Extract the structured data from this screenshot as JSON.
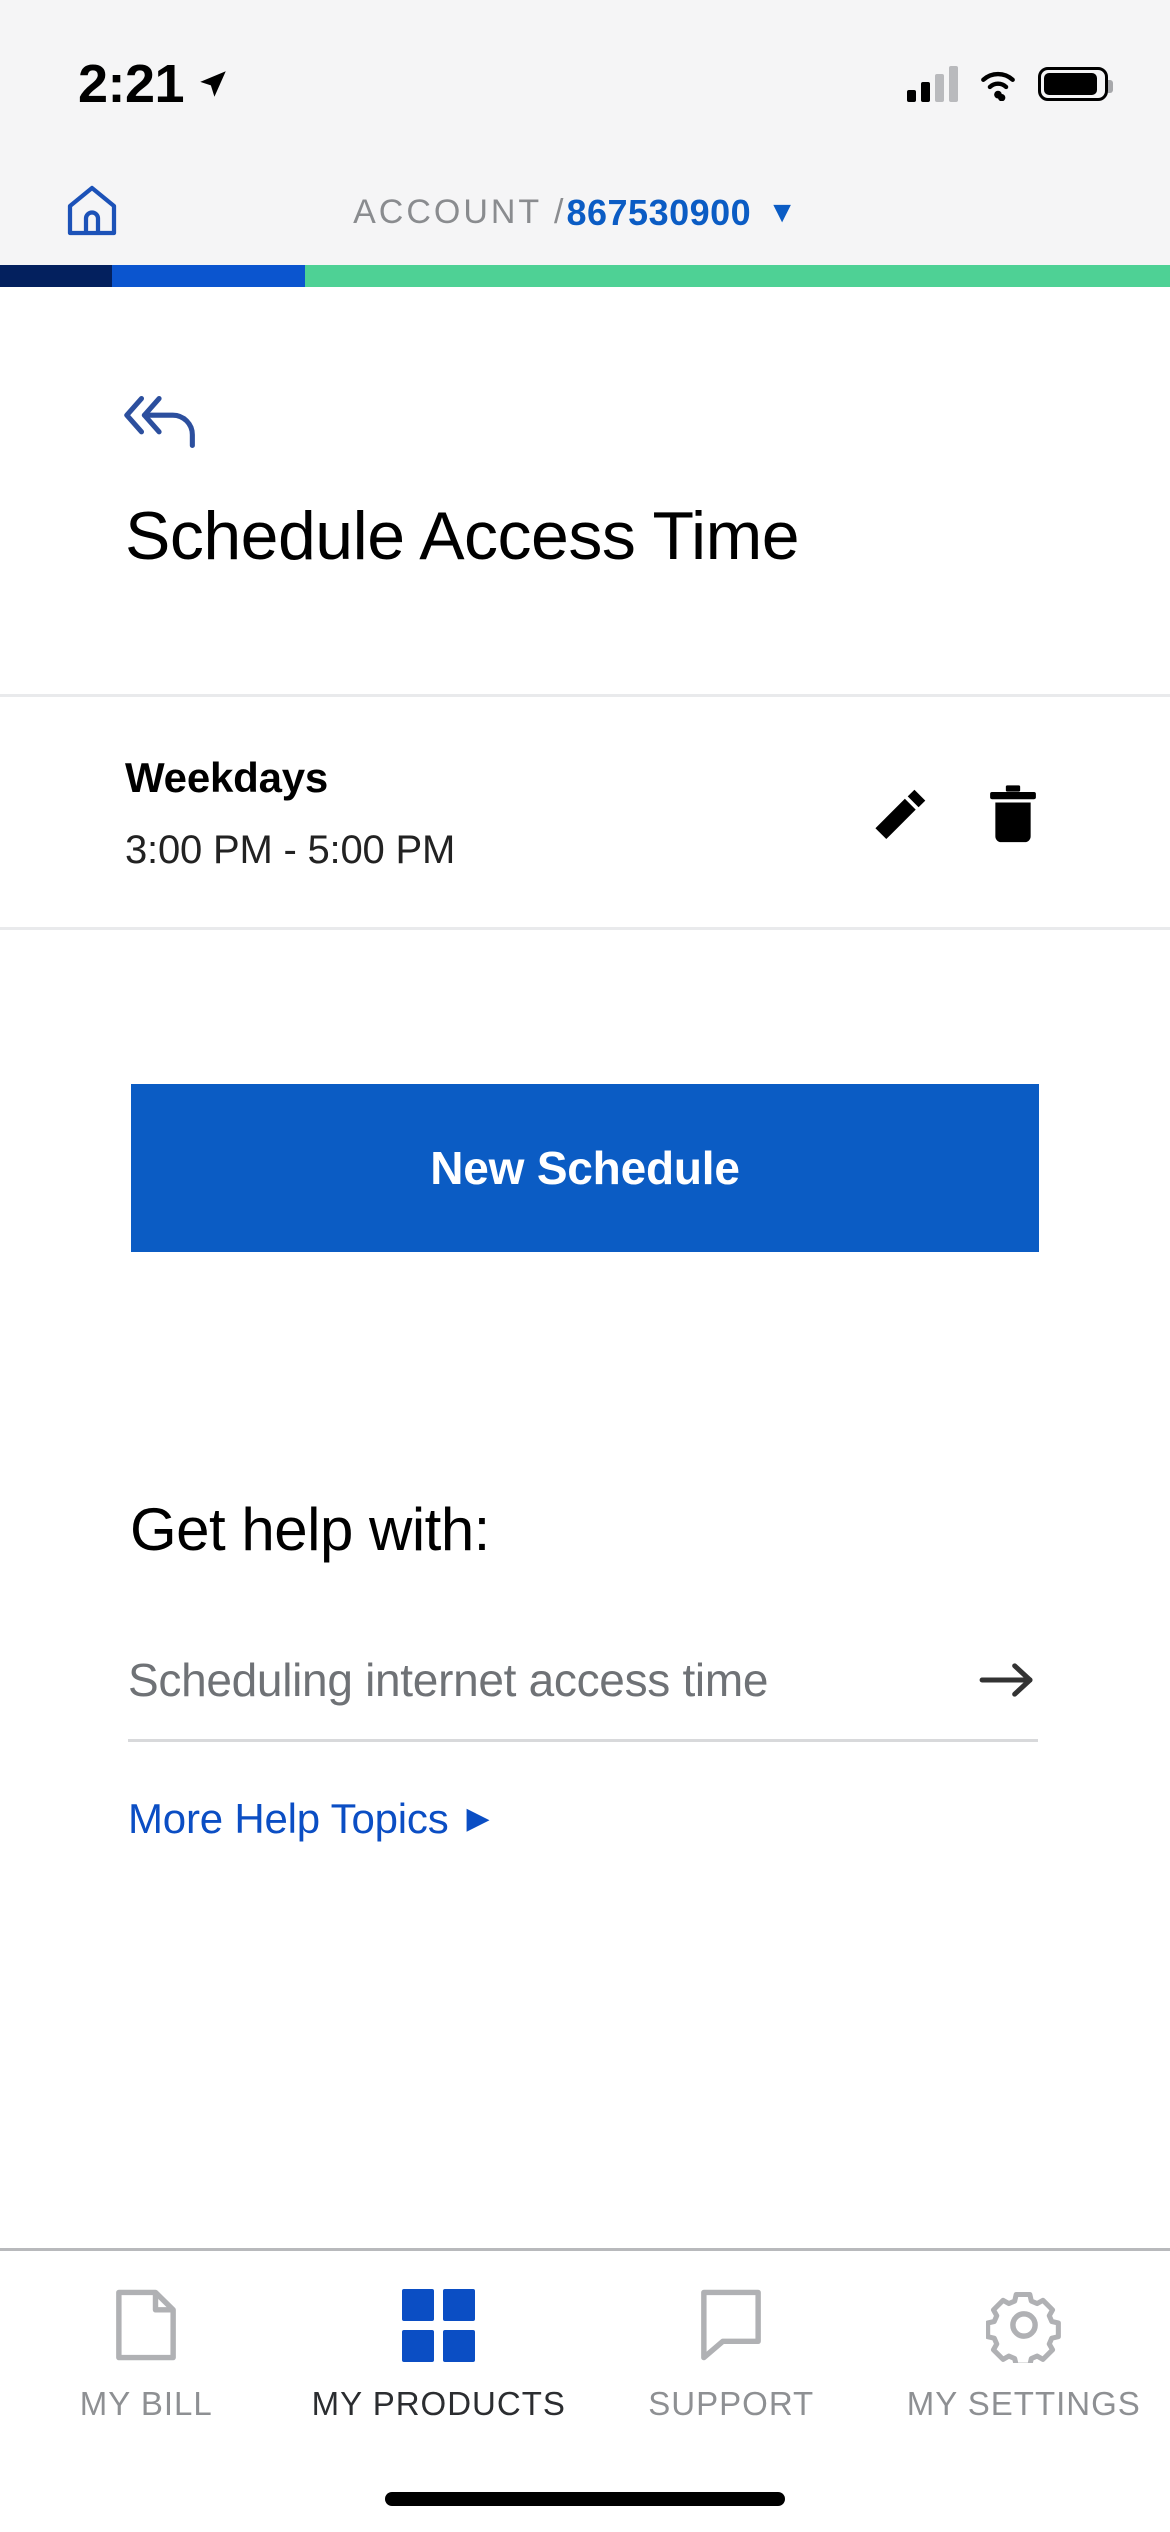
{
  "status_bar": {
    "time": "2:21",
    "location_icon": "location-arrow-icon",
    "signal_icon": "cellular-signal-icon",
    "wifi_icon": "wifi-icon",
    "battery_icon": "battery-icon"
  },
  "header": {
    "home_icon": "home-icon",
    "account_label": "ACCOUNT /",
    "account_number": "867530900",
    "caret": "▼",
    "accent_color": "#0b5cc4",
    "bar_colors": [
      "#03205e",
      "#0b55cf",
      "#4ed195"
    ]
  },
  "page": {
    "back_icon": "back-arrow-icon",
    "title": "Schedule Access Time"
  },
  "schedule": {
    "items": [
      {
        "days": "Weekdays",
        "time_range": "3:00 PM - 5:00 PM",
        "edit_icon": "pencil-icon",
        "delete_icon": "trash-icon"
      }
    ],
    "new_button_label": "New Schedule"
  },
  "help": {
    "heading": "Get help with:",
    "topics": [
      {
        "label": "Scheduling internet access time",
        "arrow_icon": "arrow-right-icon"
      }
    ],
    "more_link": "More Help Topics",
    "more_link_arrow": "▶"
  },
  "bottom_nav": {
    "items": [
      {
        "label": "MY BILL",
        "icon": "document-icon",
        "active": false
      },
      {
        "label": "MY PRODUCTS",
        "icon": "grid-icon",
        "active": true
      },
      {
        "label": "SUPPORT",
        "icon": "speech-bubble-icon",
        "active": false
      },
      {
        "label": "MY SETTINGS",
        "icon": "gear-icon",
        "active": false
      }
    ]
  }
}
